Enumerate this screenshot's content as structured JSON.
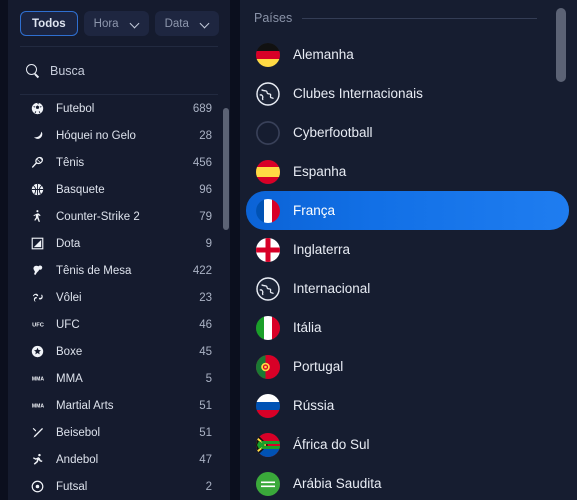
{
  "filters": {
    "all_label": "Todos",
    "time_label": "Hora",
    "date_label": "Data"
  },
  "search": {
    "label": "Busca",
    "placeholder": "Busca",
    "value": ""
  },
  "sports": {
    "items": [
      {
        "icon": "soccer-ball-icon",
        "label": "Futebol",
        "count": "689"
      },
      {
        "icon": "ice-hockey-icon",
        "label": "Hóquei no Gelo",
        "count": "28"
      },
      {
        "icon": "tennis-racket-icon",
        "label": "Tênis",
        "count": "456"
      },
      {
        "icon": "basketball-icon",
        "label": "Basquete",
        "count": "96"
      },
      {
        "icon": "counter-strike-icon",
        "label": "Counter-Strike 2",
        "count": "79"
      },
      {
        "icon": "dota-icon",
        "label": "Dota",
        "count": "9"
      },
      {
        "icon": "table-tennis-icon",
        "label": "Tênis de Mesa",
        "count": "422"
      },
      {
        "icon": "volleyball-icon",
        "label": "Vôlei",
        "count": "23"
      },
      {
        "icon": "ufc-icon",
        "label": "UFC",
        "count": "46"
      },
      {
        "icon": "boxing-icon",
        "label": "Boxe",
        "count": "45"
      },
      {
        "icon": "mma-icon",
        "label": "MMA",
        "count": "5"
      },
      {
        "icon": "martial-arts-icon",
        "label": "Martial Arts",
        "count": "51"
      },
      {
        "icon": "baseball-icon",
        "label": "Beisebol",
        "count": "51"
      },
      {
        "icon": "handball-icon",
        "label": "Andebol",
        "count": "47"
      },
      {
        "icon": "futsal-icon",
        "label": "Futsal",
        "count": "2"
      }
    ]
  },
  "countries": {
    "header": "Países",
    "items": [
      {
        "flag": "flag-germany-icon",
        "label": "Alemanha",
        "selected": false
      },
      {
        "flag": "globe-icon",
        "label": "Clubes Internacionais",
        "selected": false
      },
      {
        "flag": "blank-circle-icon",
        "label": "Cyberfootball",
        "selected": false
      },
      {
        "flag": "flag-spain-icon",
        "label": "Espanha",
        "selected": false
      },
      {
        "flag": "flag-france-icon",
        "label": "França",
        "selected": true
      },
      {
        "flag": "flag-england-icon",
        "label": "Inglaterra",
        "selected": false
      },
      {
        "flag": "globe-icon",
        "label": "Internacional",
        "selected": false
      },
      {
        "flag": "flag-italy-icon",
        "label": "Itália",
        "selected": false
      },
      {
        "flag": "flag-portugal-icon",
        "label": "Portugal",
        "selected": false
      },
      {
        "flag": "flag-russia-icon",
        "label": "Rússia",
        "selected": false
      },
      {
        "flag": "flag-south-africa-icon",
        "label": "África do Sul",
        "selected": false
      },
      {
        "flag": "flag-saudi-arabia-icon",
        "label": "Arábia Saudita",
        "selected": false
      }
    ]
  },
  "colors": {
    "accent": "#1270e6",
    "panel": "#151b2e",
    "panel_right": "#161d30",
    "background": "#0b0f1e",
    "chip": "#1e2640",
    "text": "#dde2ec",
    "muted": "#8a93a8",
    "scrollbar": "#5c6375"
  }
}
